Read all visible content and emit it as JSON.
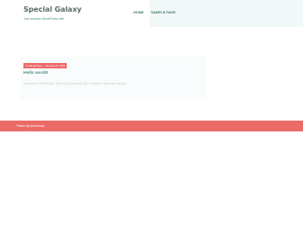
{
  "header": {
    "site_title": "Special Galaxy",
    "tagline": "Just another WordPress site"
  },
  "nav": {
    "items": [
      {
        "label": "Home"
      },
      {
        "label": "Sample Page"
      }
    ]
  },
  "post": {
    "meta": "Uncategorized — January 24, 2022",
    "title": "Hello world!",
    "excerpt": "Welcome to WordPress. This is your first post. Edit or delete it, then start writing!"
  },
  "footer": {
    "credit": "Theme by www.luxury"
  },
  "colors": {
    "accent": "#ec6a68",
    "header_band": "#f1f8f7",
    "title_text": "#5a6e6d",
    "link_text": "#4d8f8c"
  }
}
